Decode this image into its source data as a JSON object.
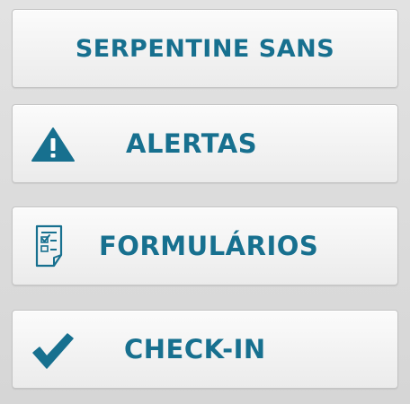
{
  "colors": {
    "accent": "#17708f",
    "button_bg": "#f4f4f4",
    "page_bg": "#dcdcdc"
  },
  "menu": {
    "items": [
      {
        "label": "SERPENTINE SANS",
        "icon": null
      },
      {
        "label": "ALERTAS",
        "icon": "warning-icon"
      },
      {
        "label": "FORMULÁRIOS",
        "icon": "form-checklist-icon"
      },
      {
        "label": "CHECK-IN",
        "icon": "checkmark-icon"
      }
    ]
  }
}
